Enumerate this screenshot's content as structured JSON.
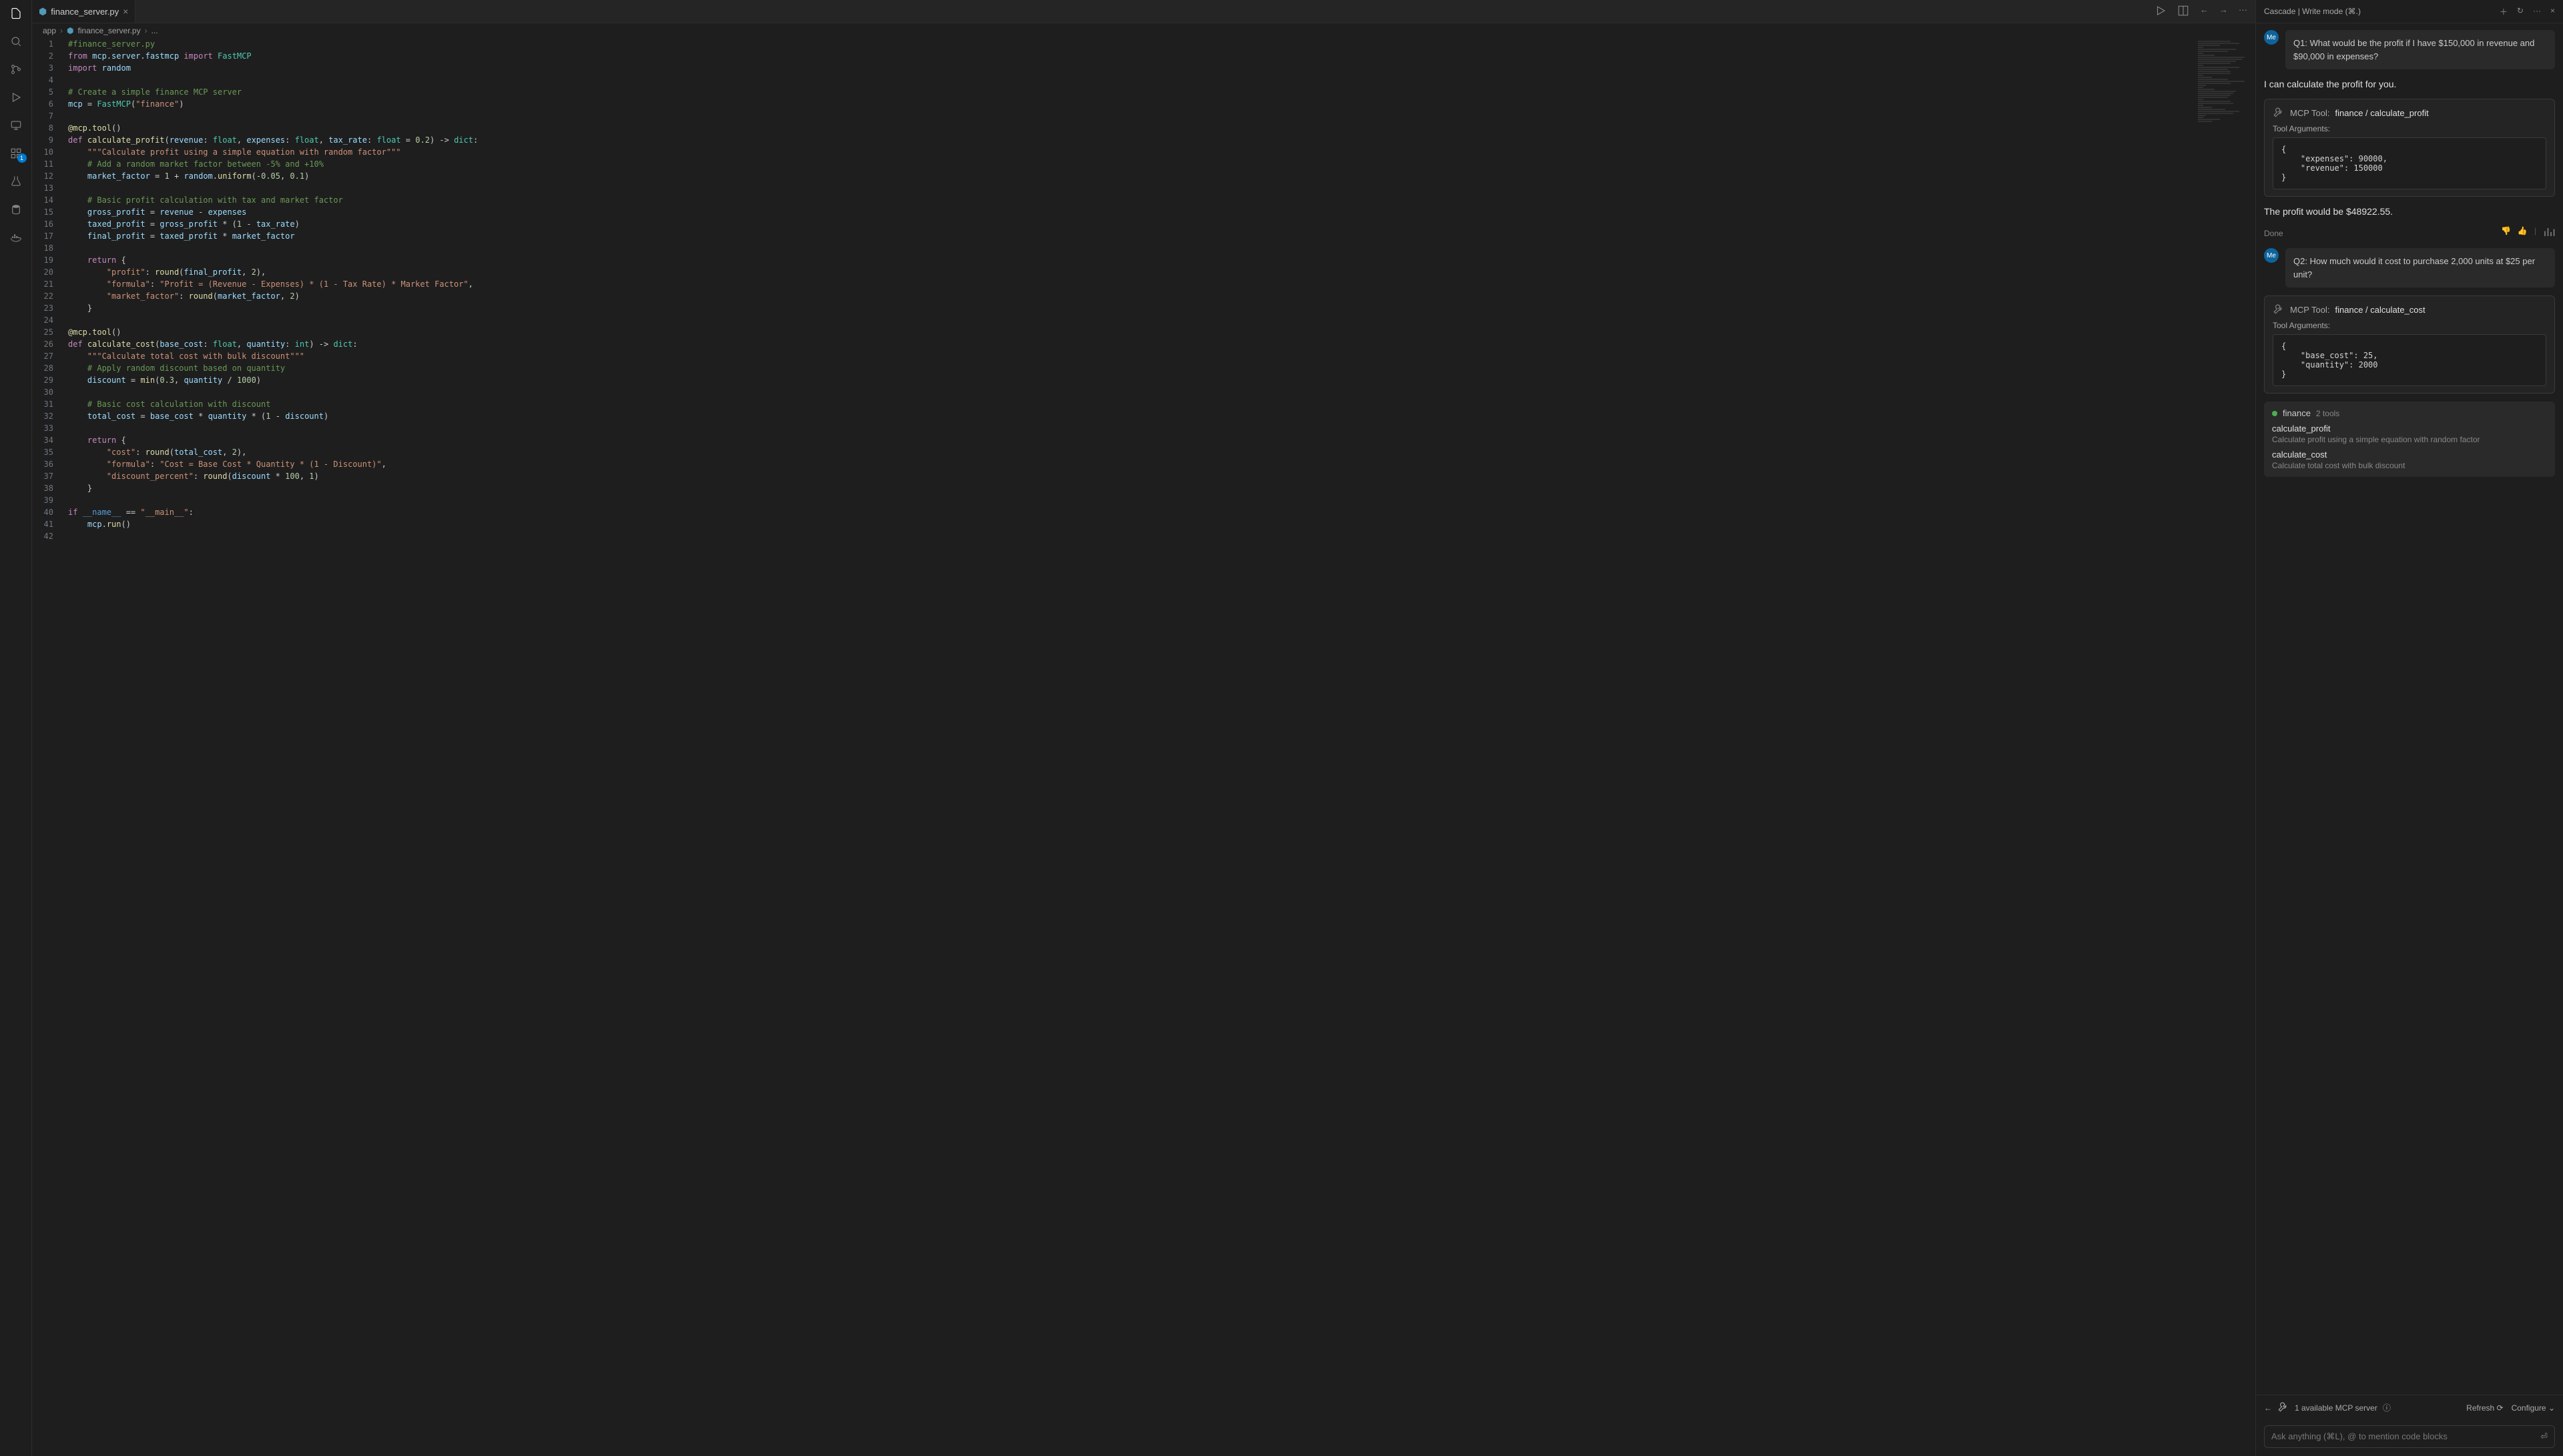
{
  "tab": {
    "title": "finance_server.py",
    "icon": "python-icon"
  },
  "breadcrumbs": {
    "seg1": "app",
    "seg2": "finance_server.py",
    "seg3": "..."
  },
  "editor_actions": {
    "run": "▷",
    "split": "▢",
    "back": "←",
    "fwd": "→",
    "more": "···"
  },
  "code": {
    "lines": [
      {
        "n": 1,
        "html": "<span class='tok-comment'>#finance_server.py</span>"
      },
      {
        "n": 2,
        "html": "<span class='tok-keyword'>from</span> <span class='tok-var'>mcp.server.fastmcp</span> <span class='tok-keyword'>import</span> <span class='tok-class'>FastMCP</span>"
      },
      {
        "n": 3,
        "html": "<span class='tok-keyword'>import</span> <span class='tok-var'>random</span>"
      },
      {
        "n": 4,
        "html": ""
      },
      {
        "n": 5,
        "html": "<span class='tok-comment'># Create a simple finance MCP server</span>"
      },
      {
        "n": 6,
        "html": "<span class='tok-var'>mcp</span> = <span class='tok-class'>FastMCP</span>(<span class='tok-string'>\"finance\"</span>)"
      },
      {
        "n": 7,
        "html": ""
      },
      {
        "n": 8,
        "html": "<span class='tok-deco'>@mcp.tool</span>()"
      },
      {
        "n": 9,
        "html": "<span class='tok-keyword'>def</span> <span class='tok-func'>calculate_profit</span>(<span class='tok-param'>revenue</span>: <span class='tok-type'>float</span>, <span class='tok-param'>expenses</span>: <span class='tok-type'>float</span>, <span class='tok-param'>tax_rate</span>: <span class='tok-type'>float</span> = <span class='tok-num'>0.2</span>) -&gt; <span class='tok-type'>dict</span>:"
      },
      {
        "n": 10,
        "html": "    <span class='tok-string'>\"\"\"Calculate profit using a simple equation with random factor\"\"\"</span>"
      },
      {
        "n": 11,
        "html": "    <span class='tok-comment'># Add a random market factor between -5% and +10%</span>"
      },
      {
        "n": 12,
        "html": "    <span class='tok-var'>market_factor</span> = <span class='tok-num'>1</span> + <span class='tok-var'>random</span>.<span class='tok-func'>uniform</span>(<span class='tok-num'>-0.05</span>, <span class='tok-num'>0.1</span>)"
      },
      {
        "n": 13,
        "html": ""
      },
      {
        "n": 14,
        "html": "    <span class='tok-comment'># Basic profit calculation with tax and market factor</span>"
      },
      {
        "n": 15,
        "html": "    <span class='tok-var'>gross_profit</span> = <span class='tok-var'>revenue</span> - <span class='tok-var'>expenses</span>"
      },
      {
        "n": 16,
        "html": "    <span class='tok-var'>taxed_profit</span> = <span class='tok-var'>gross_profit</span> * (<span class='tok-num'>1</span> - <span class='tok-var'>tax_rate</span>)"
      },
      {
        "n": 17,
        "html": "    <span class='tok-var'>final_profit</span> = <span class='tok-var'>taxed_profit</span> * <span class='tok-var'>market_factor</span>"
      },
      {
        "n": 18,
        "html": ""
      },
      {
        "n": 19,
        "html": "    <span class='tok-keyword'>return</span> {"
      },
      {
        "n": 20,
        "html": "        <span class='tok-string'>\"profit\"</span>: <span class='tok-func'>round</span>(<span class='tok-var'>final_profit</span>, <span class='tok-num'>2</span>),"
      },
      {
        "n": 21,
        "html": "        <span class='tok-string'>\"formula\"</span>: <span class='tok-string'>\"Profit = (Revenue - Expenses) * (1 - Tax Rate) * Market Factor\"</span>,"
      },
      {
        "n": 22,
        "html": "        <span class='tok-string'>\"market_factor\"</span>: <span class='tok-func'>round</span>(<span class='tok-var'>market_factor</span>, <span class='tok-num'>2</span>)"
      },
      {
        "n": 23,
        "html": "    }"
      },
      {
        "n": 24,
        "html": ""
      },
      {
        "n": 25,
        "html": "<span class='tok-deco'>@mcp.tool</span>()"
      },
      {
        "n": 26,
        "html": "<span class='tok-keyword'>def</span> <span class='tok-func'>calculate_cost</span>(<span class='tok-param'>base_cost</span>: <span class='tok-type'>float</span>, <span class='tok-param'>quantity</span>: <span class='tok-type'>int</span>) -&gt; <span class='tok-type'>dict</span>:"
      },
      {
        "n": 27,
        "html": "    <span class='tok-string'>\"\"\"Calculate total cost with bulk discount\"\"\"</span>"
      },
      {
        "n": 28,
        "html": "    <span class='tok-comment'># Apply random discount based on quantity</span>"
      },
      {
        "n": 29,
        "html": "    <span class='tok-var'>discount</span> = <span class='tok-func'>min</span>(<span class='tok-num'>0.3</span>, <span class='tok-var'>quantity</span> / <span class='tok-num'>1000</span>)"
      },
      {
        "n": 30,
        "html": ""
      },
      {
        "n": 31,
        "html": "    <span class='tok-comment'># Basic cost calculation with discount</span>"
      },
      {
        "n": 32,
        "html": "    <span class='tok-var'>total_cost</span> = <span class='tok-var'>base_cost</span> * <span class='tok-var'>quantity</span> * (<span class='tok-num'>1</span> - <span class='tok-var'>discount</span>)"
      },
      {
        "n": 33,
        "html": ""
      },
      {
        "n": 34,
        "html": "    <span class='tok-keyword'>return</span> {"
      },
      {
        "n": 35,
        "html": "        <span class='tok-string'>\"cost\"</span>: <span class='tok-func'>round</span>(<span class='tok-var'>total_cost</span>, <span class='tok-num'>2</span>),"
      },
      {
        "n": 36,
        "html": "        <span class='tok-string'>\"formula\"</span>: <span class='tok-string'>\"Cost = Base Cost * Quantity * (1 - Discount)\"</span>,"
      },
      {
        "n": 37,
        "html": "        <span class='tok-string'>\"discount_percent\"</span>: <span class='tok-func'>round</span>(<span class='tok-var'>discount</span> * <span class='tok-num'>100</span>, <span class='tok-num'>1</span>)"
      },
      {
        "n": 38,
        "html": "    }"
      },
      {
        "n": 39,
        "html": ""
      },
      {
        "n": 40,
        "html": "<span class='tok-keyword'>if</span> <span class='tok-builtin'>__name__</span> == <span class='tok-string'>\"__main__\"</span>:"
      },
      {
        "n": 41,
        "html": "    <span class='tok-var'>mcp</span>.<span class='tok-func'>run</span>()"
      },
      {
        "n": 42,
        "html": ""
      }
    ]
  },
  "cascade": {
    "title": "Cascade | Write mode  (⌘.)",
    "avatar": "Me",
    "q1": "Q1: What would be the profit if I have $150,000 in revenue and $90,000 in expenses?",
    "a1": "I can calculate the profit for you.",
    "tool1": {
      "prefix": "MCP Tool:",
      "name": "finance / calculate_profit",
      "args_label": "Tool Arguments:",
      "code": "{\n    \"expenses\": 90000,\n    \"revenue\": 150000\n}"
    },
    "profit_result": "The profit would be $48922.55.",
    "done": "Done",
    "q2": "Q2: How much would it cost to purchase 2,000 units at $25 per unit?",
    "tool2": {
      "prefix": "MCP Tool:",
      "name": "finance / calculate_cost",
      "args_label": "Tool Arguments:",
      "code": "{\n    \"base_cost\": 25,\n    \"quantity\": 2000\n}"
    },
    "server": {
      "name": "finance",
      "count": "2 tools",
      "t1_name": "calculate_profit",
      "t1_desc": "Calculate profit using a simple equation with random factor",
      "t2_name": "calculate_cost",
      "t2_desc": "Calculate total cost with bulk discount"
    },
    "footer": {
      "available": "1 available MCP server",
      "refresh": "Refresh",
      "configure": "Configure"
    },
    "input_placeholder": "Ask anything (⌘L), @ to mention code blocks"
  }
}
